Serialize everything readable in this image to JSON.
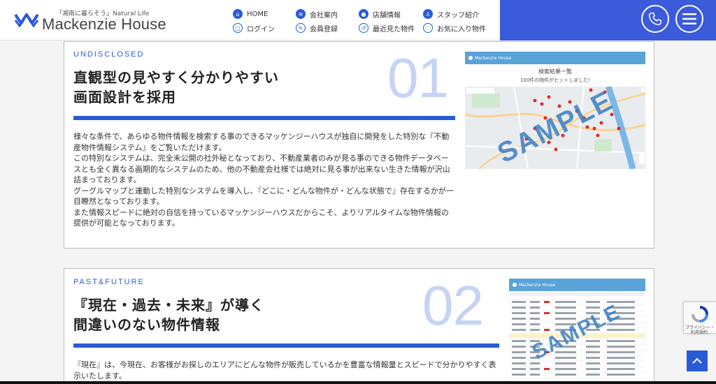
{
  "header": {
    "tagline": "「湘南に暮らそう」Natural Life",
    "site_name": "Mackenzie House",
    "nav": [
      {
        "label": "HOME",
        "icon": "home-icon"
      },
      {
        "label": "会社案内",
        "icon": "company-icon"
      },
      {
        "label": "店舗情報",
        "icon": "map-pin-icon"
      },
      {
        "label": "スタッフ紹介",
        "icon": "staff-icon"
      },
      {
        "label": "ログイン",
        "icon": "lock-icon"
      },
      {
        "label": "会員登録",
        "icon": "register-icon"
      },
      {
        "label": "最近見た物件",
        "icon": "history-icon"
      },
      {
        "label": "お気に入り物件",
        "icon": "heart-icon"
      }
    ],
    "phone_icon": "phone-icon",
    "menu_icon": "hamburger-menu-icon",
    "accent_color": "#3b5bdb"
  },
  "features": [
    {
      "eyebrow": "UNDISCLOSED",
      "number": "01",
      "title_line1": "直観型の見やすく分かりやすい",
      "title_line2": "画面設計を採用",
      "paragraphs": [
        "様々な条件で、あらゆる物件情報を検索する事のできるマッケンジーハウスが独自に開発をした特別な『不動産物件情報システム』をご覧いただけます。",
        "この特別なシステムは、完全未公開の社外秘となっており、不動産業者のみが見る事のできる物件データベースとも全く異なる画期的なシステムのため、他の不動産会社様では絶対に見る事が出来ない生きた情報が沢山詰まっております。",
        "グーグルマップと連動した特別なシステムを導入し、『どこに・どんな物件が・どんな状態で』存在するかが一目瞭然となっております。",
        "また情報スピードに絶対の自信を持っているマッケンジーハウスだからこそ、よりリアルタイムな物件情報の提供が可能となっております。"
      ],
      "shot": {
        "app_label": "Mackenzie House",
        "results_title": "検索結果一覧",
        "results_count": "100件の物件がヒットしました!",
        "watermark": "SAMPLE"
      }
    },
    {
      "eyebrow": "PAST&FUTURE",
      "number": "02",
      "title_line1": "『現在・過去・未来』が導く",
      "title_line2": "間違いのない物件情報",
      "paragraphs": [
        "『現在』は、今現在、お客様がお探しのエリアにどんな物件が販売しているかを豊富な情報量とスピードで分かりやすく表示いたします。"
      ],
      "shot": {
        "app_label": "Mackenzie House",
        "watermark": "SAMPLE"
      }
    }
  ],
  "recaptcha": {
    "line1": "プライバシー・",
    "line2": "利用規約"
  },
  "back_to_top_icon": "chevron-up-icon"
}
